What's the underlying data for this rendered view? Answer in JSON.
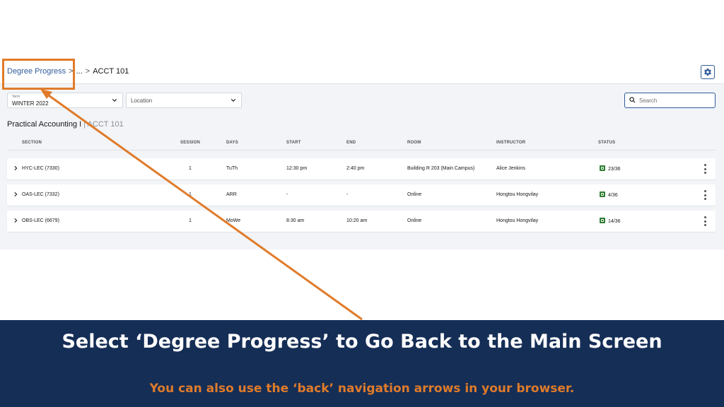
{
  "breadcrumb": {
    "link": "Degree Progress",
    "separator": ">",
    "ellipsis": "...",
    "current": "ACCT 101"
  },
  "filters": {
    "term_label": "Term",
    "term_value": "WINTER 2022",
    "location_placeholder": "Location",
    "search_placeholder": "Search"
  },
  "course": {
    "name": "Practical Accounting I",
    "separator": "|",
    "code": "ACCT 101"
  },
  "table": {
    "headers": [
      "SECTION",
      "SESSION",
      "DAYS",
      "START",
      "END",
      "ROOM",
      "INSTRUCTOR",
      "STATUS"
    ],
    "rows": [
      {
        "section": "HYC-LEC (7330)",
        "session": "1",
        "days": "TuTh",
        "start": "12:30 pm",
        "end": "2:40 pm",
        "room": "Building R 203 (Main Campus)",
        "instructor": "Alice Jenkins",
        "status": "23/36"
      },
      {
        "section": "OAS-LEC (7332)",
        "session": "1",
        "days": "ARR",
        "start": "-",
        "end": "-",
        "room": "Online",
        "instructor": "Hongtou Hongvilay",
        "status": "4/36"
      },
      {
        "section": "OBS-LEC (6679)",
        "session": "1",
        "days": "MoWe",
        "start": "8:30 am",
        "end": "10:20 am",
        "room": "Online",
        "instructor": "Hongtou Hongvilay",
        "status": "14/36"
      }
    ]
  },
  "banner": {
    "title": "Select ‘Degree Progress’ to Go Back to the Main Screen",
    "subtitle": "You can also use the ‘back’ navigation arrows in your browser."
  },
  "colors": {
    "accent_orange": "#e07b2a",
    "banner_navy": "#152e56",
    "link_blue": "#2f5b9a",
    "status_green": "#2e7d32"
  },
  "icons": [
    "gear-icon",
    "chevron-down-icon",
    "search-icon",
    "chevron-right-icon",
    "kebab-menu-icon",
    "status-open-icon"
  ]
}
